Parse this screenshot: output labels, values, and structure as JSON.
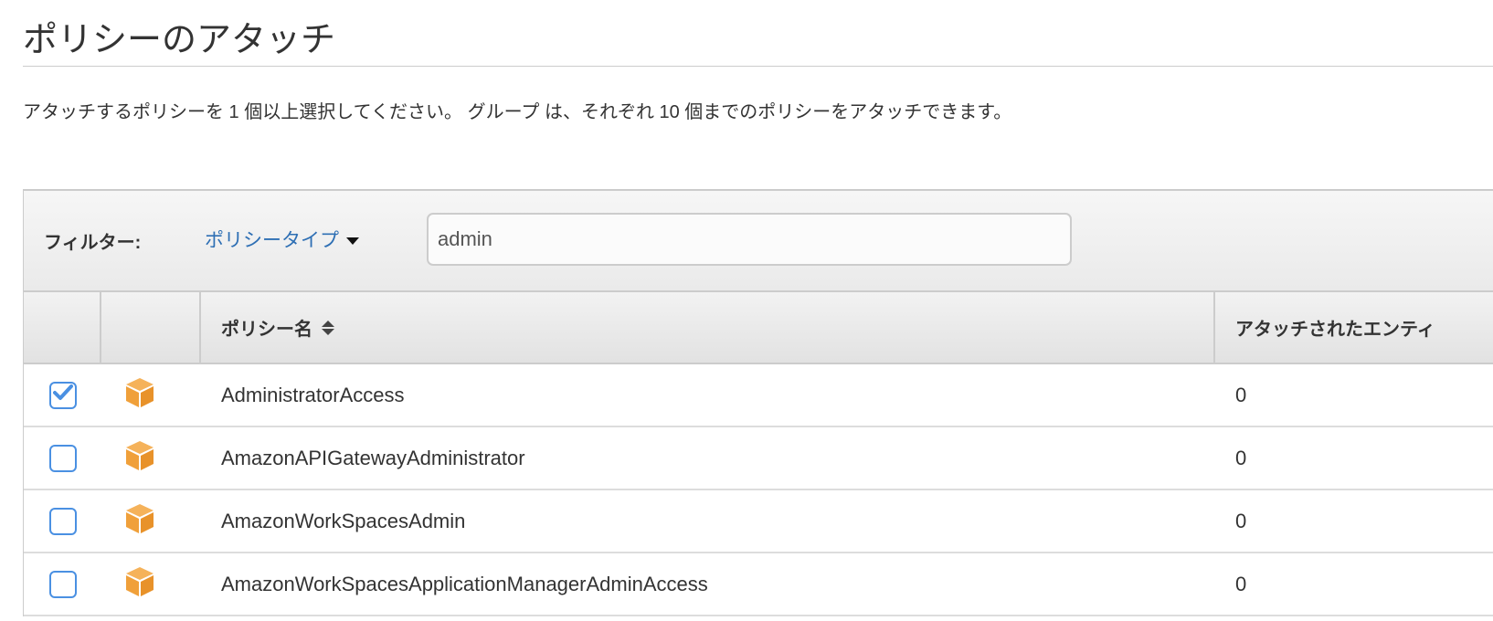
{
  "page": {
    "title": "ポリシーのアタッチ",
    "description": "アタッチするポリシーを 1 個以上選択してください。 グループ は、それぞれ 10 個までのポリシーをアタッチできます。"
  },
  "filter": {
    "label": "フィルター:",
    "type_dropdown": "ポリシータイプ",
    "search_value": "admin"
  },
  "table": {
    "columns": [
      "",
      "",
      "ポリシー名",
      "アタッチされたエンティ"
    ],
    "rows": [
      {
        "name": "AdministratorAccess",
        "attached": "0",
        "checked": true
      },
      {
        "name": "AmazonAPIGatewayAdministrator",
        "attached": "0",
        "checked": false
      },
      {
        "name": "AmazonWorkSpacesAdmin",
        "attached": "0",
        "checked": false
      },
      {
        "name": "AmazonWorkSpacesApplicationManagerAdminAccess",
        "attached": "0",
        "checked": false
      }
    ]
  },
  "colors": {
    "link": "#2e6fb4",
    "checkbox": "#4a90e2",
    "aws_icon": "#f0a03a"
  }
}
